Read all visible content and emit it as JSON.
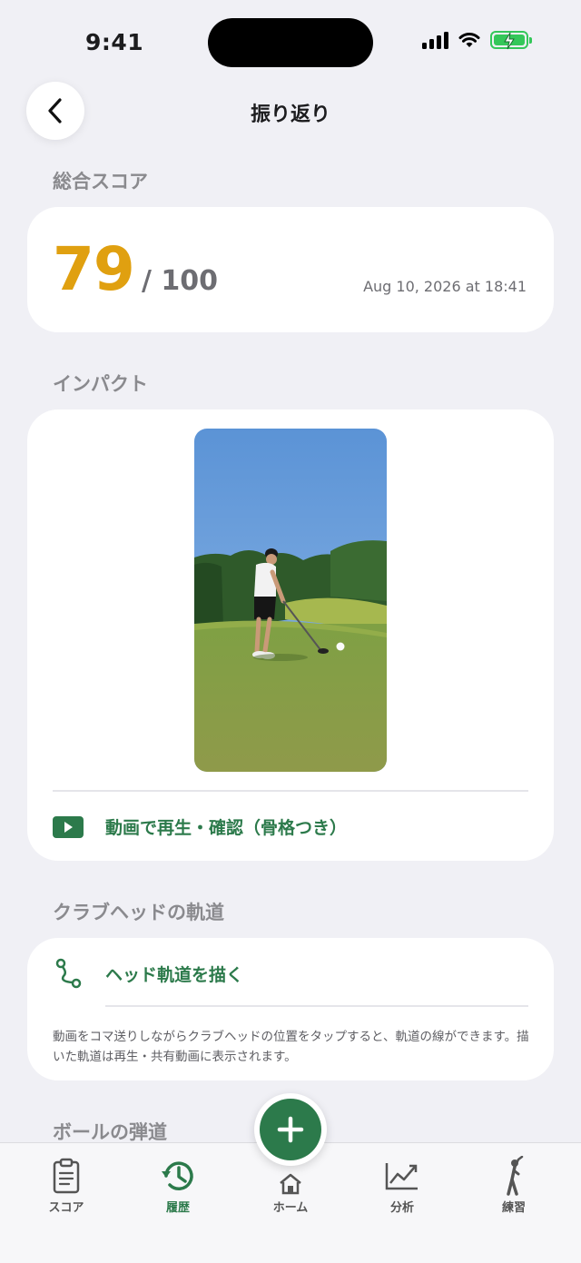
{
  "status_bar": {
    "time": "9:41"
  },
  "nav": {
    "title": "振り返り"
  },
  "score_section": {
    "label": "総合スコア",
    "score": "79",
    "max": "/ 100",
    "date": "Aug 10, 2026 at 18:41"
  },
  "impact_section": {
    "label": "インパクト",
    "play_label": "動画で再生・確認（骨格つき）"
  },
  "trajectory_section": {
    "label": "クラブヘッドの軌道",
    "draw_label": "ヘッド軌道を描く",
    "note": "動画をコマ送りしながらクラブヘッドの位置をタップすると、軌道の線ができます。描いた軌道は再生・共有動画に表示されます。"
  },
  "ball_section": {
    "label": "ボールの弾道"
  },
  "tabbar": {
    "items": [
      {
        "label": "スコア",
        "icon": "clipboard-icon"
      },
      {
        "label": "履歴",
        "icon": "history-icon",
        "active": true
      },
      {
        "label": "ホーム",
        "icon": "home-icon"
      },
      {
        "label": "分析",
        "icon": "chart-icon"
      },
      {
        "label": "練習",
        "icon": "golfer-icon"
      }
    ]
  },
  "colors": {
    "accent": "#2c7a4b",
    "score": "#e0a010",
    "background": "#f0f0f5"
  }
}
